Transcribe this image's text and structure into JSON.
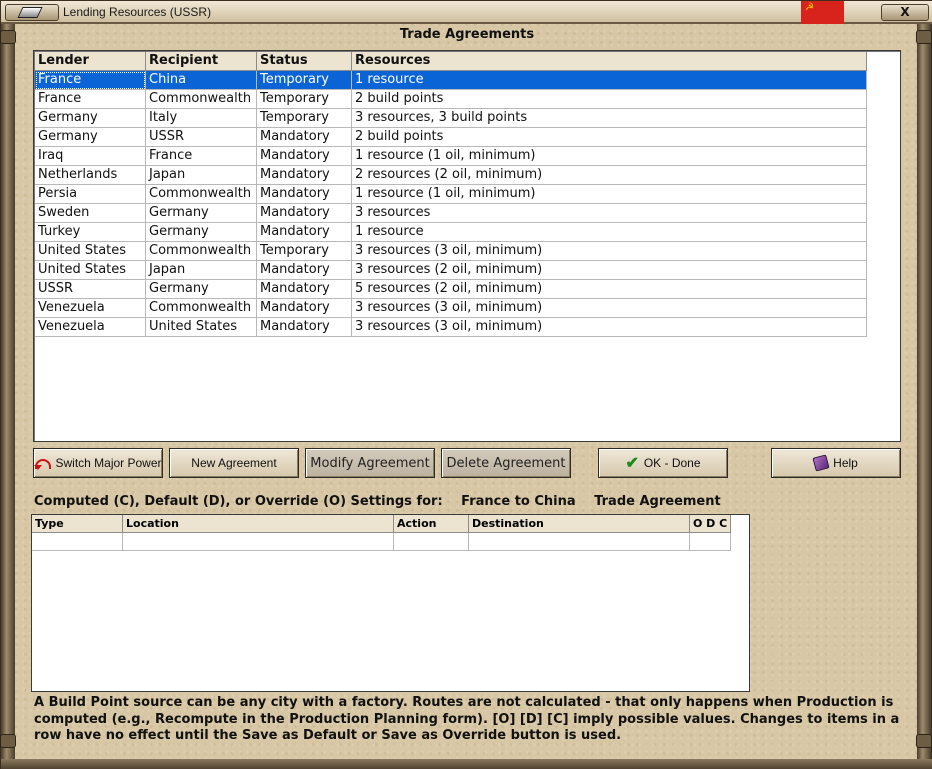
{
  "window": {
    "title": "Lending Resources (USSR)",
    "close_glyph": "X",
    "flag_symbol": "☭"
  },
  "heading": "Trade Agreements",
  "table": {
    "headers": [
      "Lender",
      "Recipient",
      "Status",
      "Resources"
    ],
    "rows": [
      [
        "France",
        "China",
        "Temporary",
        "1 resource"
      ],
      [
        "France",
        "Commonwealth",
        "Temporary",
        "2 build points"
      ],
      [
        "Germany",
        "Italy",
        "Temporary",
        "3 resources, 3 build points"
      ],
      [
        "Germany",
        "USSR",
        "Mandatory",
        "2 build points"
      ],
      [
        "Iraq",
        "France",
        "Mandatory",
        "1 resource (1 oil, minimum)"
      ],
      [
        "Netherlands",
        "Japan",
        "Mandatory",
        "2 resources (2 oil, minimum)"
      ],
      [
        "Persia",
        "Commonwealth",
        "Mandatory",
        "1 resource (1 oil, minimum)"
      ],
      [
        "Sweden",
        "Germany",
        "Mandatory",
        "3 resources"
      ],
      [
        "Turkey",
        "Germany",
        "Mandatory",
        "1 resource"
      ],
      [
        "United States",
        "Commonwealth",
        "Temporary",
        "3 resources (3 oil, minimum)"
      ],
      [
        "United States",
        "Japan",
        "Mandatory",
        "3 resources (2 oil, minimum)"
      ],
      [
        "USSR",
        "Germany",
        "Mandatory",
        "5 resources (2 oil, minimum)"
      ],
      [
        "Venezuela",
        "Commonwealth",
        "Mandatory",
        "3 resources (3 oil, minimum)"
      ],
      [
        "Venezuela",
        "United States",
        "Mandatory",
        "3 resources (3 oil, minimum)"
      ]
    ],
    "selected_row": 0
  },
  "buttons": {
    "switch_major_power": "Switch Major Power",
    "new_agreement": "New Agreement",
    "modify_agreement": "Modify Agreement",
    "delete_agreement": "Delete Agreement",
    "ok_done": "OK - Done",
    "help": "Help"
  },
  "settings": {
    "label": "Computed (C), Default (D), or Override (O) Settings for:",
    "route": "France to China",
    "kind": "Trade Agreement",
    "headers": [
      "Type",
      "Location",
      "Action",
      "Destination",
      "O D C"
    ]
  },
  "info": "A Build Point source can be any city with a factory. Routes are not calculated - that only happens when Production is computed (e.g., Recompute in the Production Planning form).  [O] [D] [C] imply possible values.  Changes to items in a row have no effect until the Save as Default or Save as Override button is used.",
  "colors": {
    "selection": "#0a64d6",
    "background": "#d8c7a5"
  }
}
